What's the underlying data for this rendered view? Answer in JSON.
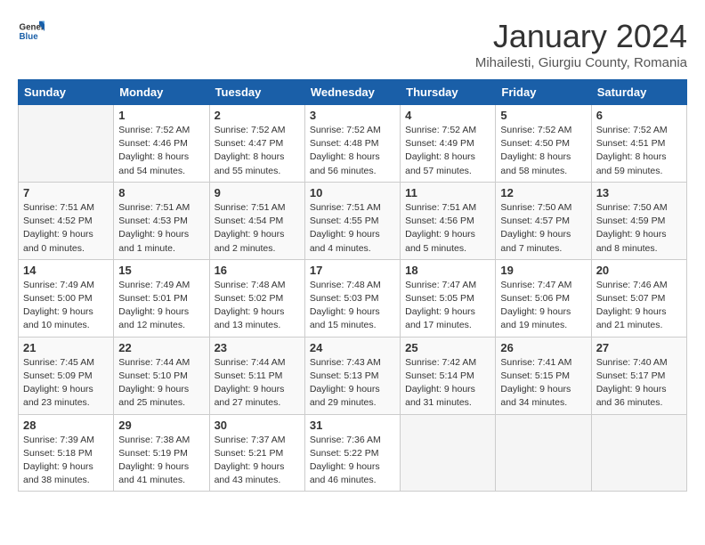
{
  "header": {
    "logo_general": "General",
    "logo_blue": "Blue",
    "month_title": "January 2024",
    "location": "Mihailesti, Giurgiu County, Romania"
  },
  "weekdays": [
    "Sunday",
    "Monday",
    "Tuesday",
    "Wednesday",
    "Thursday",
    "Friday",
    "Saturday"
  ],
  "weeks": [
    [
      {
        "day": "",
        "info": ""
      },
      {
        "day": "1",
        "info": "Sunrise: 7:52 AM\nSunset: 4:46 PM\nDaylight: 8 hours\nand 54 minutes."
      },
      {
        "day": "2",
        "info": "Sunrise: 7:52 AM\nSunset: 4:47 PM\nDaylight: 8 hours\nand 55 minutes."
      },
      {
        "day": "3",
        "info": "Sunrise: 7:52 AM\nSunset: 4:48 PM\nDaylight: 8 hours\nand 56 minutes."
      },
      {
        "day": "4",
        "info": "Sunrise: 7:52 AM\nSunset: 4:49 PM\nDaylight: 8 hours\nand 57 minutes."
      },
      {
        "day": "5",
        "info": "Sunrise: 7:52 AM\nSunset: 4:50 PM\nDaylight: 8 hours\nand 58 minutes."
      },
      {
        "day": "6",
        "info": "Sunrise: 7:52 AM\nSunset: 4:51 PM\nDaylight: 8 hours\nand 59 minutes."
      }
    ],
    [
      {
        "day": "7",
        "info": "Sunrise: 7:51 AM\nSunset: 4:52 PM\nDaylight: 9 hours\nand 0 minutes."
      },
      {
        "day": "8",
        "info": "Sunrise: 7:51 AM\nSunset: 4:53 PM\nDaylight: 9 hours\nand 1 minute."
      },
      {
        "day": "9",
        "info": "Sunrise: 7:51 AM\nSunset: 4:54 PM\nDaylight: 9 hours\nand 2 minutes."
      },
      {
        "day": "10",
        "info": "Sunrise: 7:51 AM\nSunset: 4:55 PM\nDaylight: 9 hours\nand 4 minutes."
      },
      {
        "day": "11",
        "info": "Sunrise: 7:51 AM\nSunset: 4:56 PM\nDaylight: 9 hours\nand 5 minutes."
      },
      {
        "day": "12",
        "info": "Sunrise: 7:50 AM\nSunset: 4:57 PM\nDaylight: 9 hours\nand 7 minutes."
      },
      {
        "day": "13",
        "info": "Sunrise: 7:50 AM\nSunset: 4:59 PM\nDaylight: 9 hours\nand 8 minutes."
      }
    ],
    [
      {
        "day": "14",
        "info": "Sunrise: 7:49 AM\nSunset: 5:00 PM\nDaylight: 9 hours\nand 10 minutes."
      },
      {
        "day": "15",
        "info": "Sunrise: 7:49 AM\nSunset: 5:01 PM\nDaylight: 9 hours\nand 12 minutes."
      },
      {
        "day": "16",
        "info": "Sunrise: 7:48 AM\nSunset: 5:02 PM\nDaylight: 9 hours\nand 13 minutes."
      },
      {
        "day": "17",
        "info": "Sunrise: 7:48 AM\nSunset: 5:03 PM\nDaylight: 9 hours\nand 15 minutes."
      },
      {
        "day": "18",
        "info": "Sunrise: 7:47 AM\nSunset: 5:05 PM\nDaylight: 9 hours\nand 17 minutes."
      },
      {
        "day": "19",
        "info": "Sunrise: 7:47 AM\nSunset: 5:06 PM\nDaylight: 9 hours\nand 19 minutes."
      },
      {
        "day": "20",
        "info": "Sunrise: 7:46 AM\nSunset: 5:07 PM\nDaylight: 9 hours\nand 21 minutes."
      }
    ],
    [
      {
        "day": "21",
        "info": "Sunrise: 7:45 AM\nSunset: 5:09 PM\nDaylight: 9 hours\nand 23 minutes."
      },
      {
        "day": "22",
        "info": "Sunrise: 7:44 AM\nSunset: 5:10 PM\nDaylight: 9 hours\nand 25 minutes."
      },
      {
        "day": "23",
        "info": "Sunrise: 7:44 AM\nSunset: 5:11 PM\nDaylight: 9 hours\nand 27 minutes."
      },
      {
        "day": "24",
        "info": "Sunrise: 7:43 AM\nSunset: 5:13 PM\nDaylight: 9 hours\nand 29 minutes."
      },
      {
        "day": "25",
        "info": "Sunrise: 7:42 AM\nSunset: 5:14 PM\nDaylight: 9 hours\nand 31 minutes."
      },
      {
        "day": "26",
        "info": "Sunrise: 7:41 AM\nSunset: 5:15 PM\nDaylight: 9 hours\nand 34 minutes."
      },
      {
        "day": "27",
        "info": "Sunrise: 7:40 AM\nSunset: 5:17 PM\nDaylight: 9 hours\nand 36 minutes."
      }
    ],
    [
      {
        "day": "28",
        "info": "Sunrise: 7:39 AM\nSunset: 5:18 PM\nDaylight: 9 hours\nand 38 minutes."
      },
      {
        "day": "29",
        "info": "Sunrise: 7:38 AM\nSunset: 5:19 PM\nDaylight: 9 hours\nand 41 minutes."
      },
      {
        "day": "30",
        "info": "Sunrise: 7:37 AM\nSunset: 5:21 PM\nDaylight: 9 hours\nand 43 minutes."
      },
      {
        "day": "31",
        "info": "Sunrise: 7:36 AM\nSunset: 5:22 PM\nDaylight: 9 hours\nand 46 minutes."
      },
      {
        "day": "",
        "info": ""
      },
      {
        "day": "",
        "info": ""
      },
      {
        "day": "",
        "info": ""
      }
    ]
  ]
}
